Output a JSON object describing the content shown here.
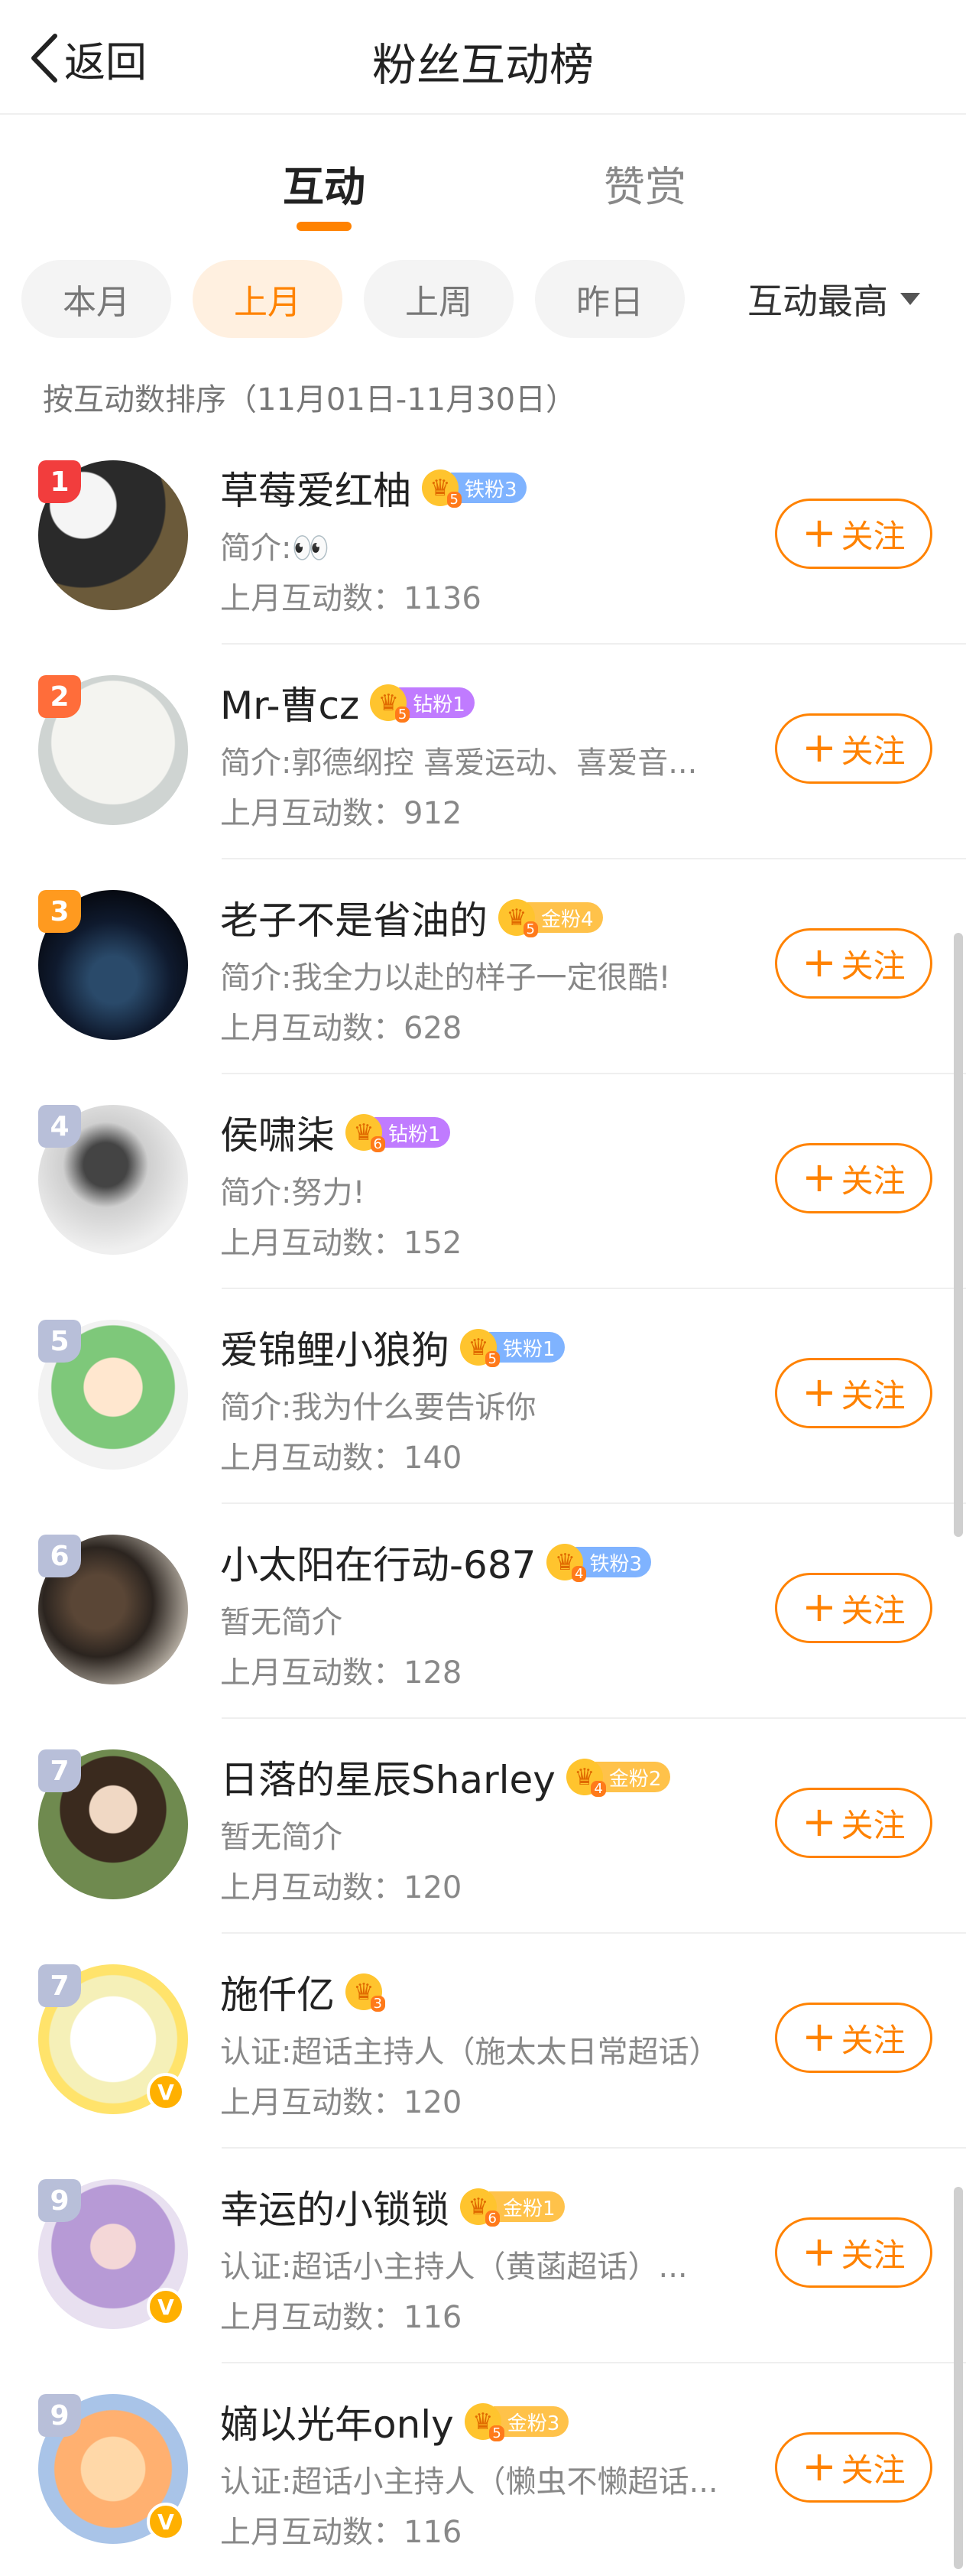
{
  "nav": {
    "back_label": "返回",
    "title": "粉丝互动榜"
  },
  "tabs": [
    {
      "label": "互动"
    },
    {
      "label": "赞赏"
    }
  ],
  "filters": {
    "chips": [
      "本月",
      "上月",
      "上周",
      "昨日"
    ],
    "selected": "上月",
    "sort_label": "互动最高"
  },
  "sort_desc": "按互动数排序（11月01日-11月30日）",
  "colors": {
    "accent": "#ff8200",
    "rank1": "#f23d3d",
    "rank2": "#ff6d3a",
    "rank3": "#ff9a1f",
    "rank_other": "#b8bfd9"
  },
  "fans": [
    {
      "rank": "1",
      "name": "草莓爱红柚",
      "crown_level": "5",
      "fan_tag": "铁粉3",
      "tag_type": "iron",
      "intro": "简介:👀",
      "count": "上月互动数：1136",
      "verified": false,
      "follow_label": "关注"
    },
    {
      "rank": "2",
      "name": "Mr-曹cz",
      "crown_level": "5",
      "fan_tag": "钻粉1",
      "tag_type": "diamond",
      "intro": "简介:郭德纲控 喜爱运动、喜爱音...",
      "count": "上月互动数：912",
      "verified": false,
      "follow_label": "关注"
    },
    {
      "rank": "3",
      "name": "老子不是省油的",
      "crown_level": "5",
      "fan_tag": "金粉4",
      "tag_type": "gold",
      "intro": "简介:我全力以赴的样子一定很酷!",
      "count": "上月互动数：628",
      "verified": false,
      "follow_label": "关注"
    },
    {
      "rank": "4",
      "name": "侯啸柒",
      "crown_level": "6",
      "fan_tag": "钻粉1",
      "tag_type": "diamond",
      "intro": "简介:努力!",
      "count": "上月互动数：152",
      "verified": false,
      "follow_label": "关注"
    },
    {
      "rank": "5",
      "name": "爱锦鲤小狼狗",
      "crown_level": "5",
      "fan_tag": "铁粉1",
      "tag_type": "iron",
      "intro": "简介:我为什么要告诉你",
      "count": "上月互动数：140",
      "verified": false,
      "follow_label": "关注"
    },
    {
      "rank": "6",
      "name": "小太阳在行动-687",
      "crown_level": "4",
      "fan_tag": "铁粉3",
      "tag_type": "iron",
      "intro": "暂无简介",
      "count": "上月互动数：128",
      "verified": false,
      "follow_label": "关注"
    },
    {
      "rank": "7",
      "name": "日落的星辰Sharley",
      "crown_level": "4",
      "fan_tag": "金粉2",
      "tag_type": "gold",
      "intro": "暂无简介",
      "count": "上月互动数：120",
      "verified": false,
      "follow_label": "关注"
    },
    {
      "rank": "7",
      "name": "施仟亿",
      "crown_level": "3",
      "fan_tag": "",
      "tag_type": "",
      "intro": "认证:超话主持人（施太太日常超话）",
      "count": "上月互动数：120",
      "verified": true,
      "follow_label": "关注"
    },
    {
      "rank": "9",
      "name": "幸运的小锁锁",
      "crown_level": "6",
      "fan_tag": "金粉1",
      "tag_type": "gold",
      "intro": "认证:超话小主持人（黄菡超话）...",
      "count": "上月互动数：116",
      "verified": true,
      "follow_label": "关注"
    },
    {
      "rank": "9",
      "name": "嫡以光年only",
      "crown_level": "5",
      "fan_tag": "金粉3",
      "tag_type": "gold",
      "intro": "认证:超话小主持人（懒虫不懒超话...",
      "count": "上月互动数：116",
      "verified": true,
      "follow_label": "关注"
    }
  ]
}
